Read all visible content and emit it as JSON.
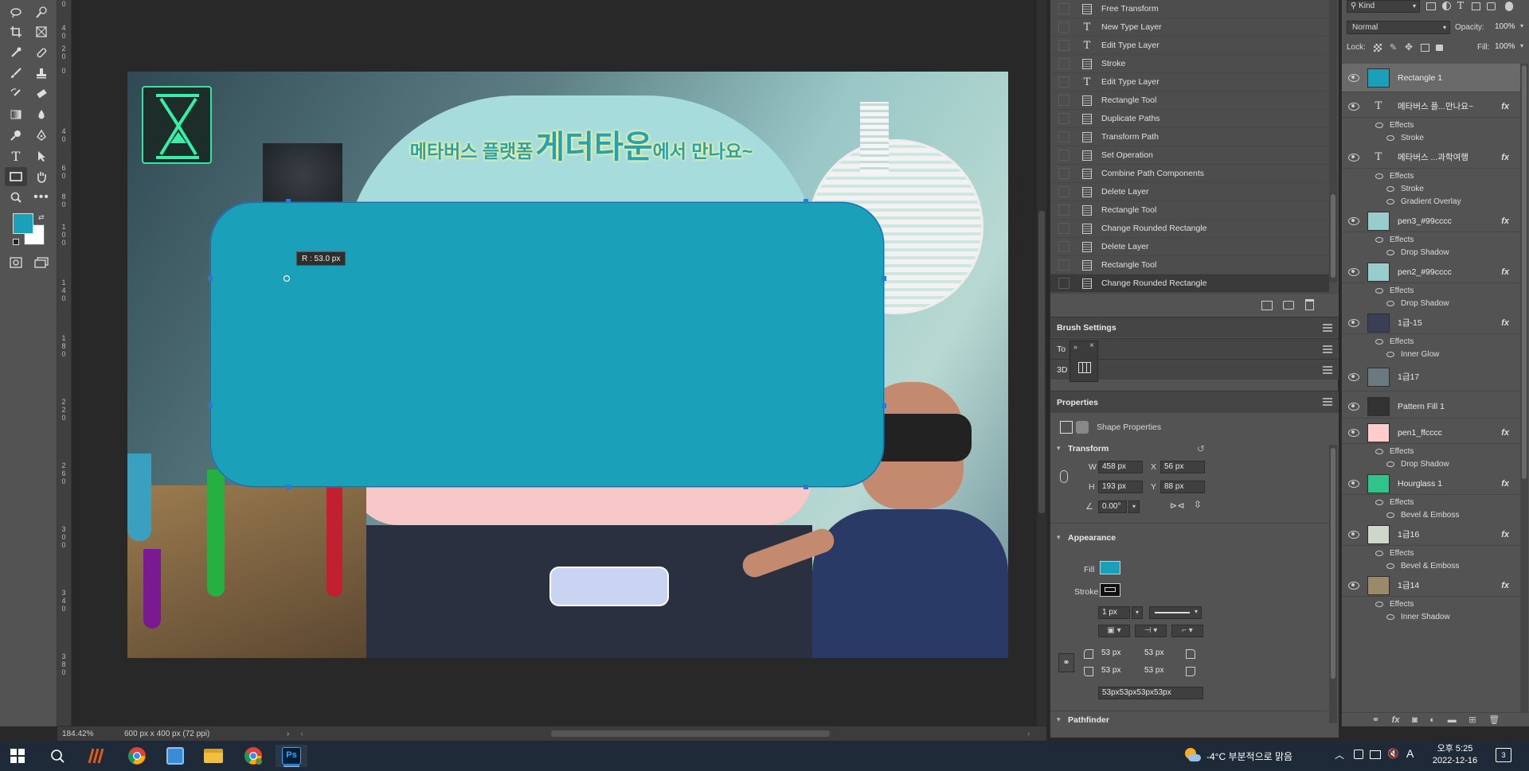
{
  "canvas": {
    "radius_tooltip": "R :  53.0 px",
    "banner_text_small_left": "메타버스 플랫폼",
    "banner_text_large": "게더타운",
    "banner_text_small_right": "에서 만나요~",
    "shape_fill": "#1aa0b8"
  },
  "status": {
    "zoom": "184.42%",
    "doc_info": "600 px x 400 px (72 ppi)"
  },
  "history": {
    "items": [
      {
        "label": "Free Transform",
        "icon": "document-icon"
      },
      {
        "label": "New Type Layer",
        "icon": "type-icon"
      },
      {
        "label": "Edit Type Layer",
        "icon": "type-icon"
      },
      {
        "label": "Stroke",
        "icon": "document-icon"
      },
      {
        "label": "Edit Type Layer",
        "icon": "type-icon"
      },
      {
        "label": "Rectangle Tool",
        "icon": "document-icon"
      },
      {
        "label": "Duplicate Paths",
        "icon": "document-icon"
      },
      {
        "label": "Transform Path",
        "icon": "document-icon"
      },
      {
        "label": "Set Operation",
        "icon": "document-icon"
      },
      {
        "label": "Combine Path Components",
        "icon": "document-icon"
      },
      {
        "label": "Delete Layer",
        "icon": "document-icon"
      },
      {
        "label": "Rectangle Tool",
        "icon": "document-icon"
      },
      {
        "label": "Change Rounded Rectangle",
        "icon": "document-icon"
      },
      {
        "label": "Delete Layer",
        "icon": "document-icon"
      },
      {
        "label": "Rectangle Tool",
        "icon": "document-icon"
      },
      {
        "label": "Change Rounded Rectangle",
        "icon": "document-icon"
      }
    ]
  },
  "panels": {
    "brush_settings": "Brush Settings",
    "tools_tab": "To",
    "tools_tab_end": "s",
    "threed_tab": "3D",
    "properties": "Properties",
    "shape_properties": "Shape Properties"
  },
  "transform": {
    "title": "Transform",
    "w_label": "W",
    "w": "458 px",
    "x_label": "X",
    "x": "56 px",
    "h_label": "H",
    "h": "193 px",
    "y_label": "Y",
    "y": "88 px",
    "angle": "0.00°"
  },
  "appearance": {
    "title": "Appearance",
    "fill_label": "Fill",
    "stroke_label": "Stroke",
    "stroke_width": "1 px",
    "fill_color": "#1aa0b8",
    "corner_tl": "53 px",
    "corner_tr": "53 px",
    "corner_bl": "53 px",
    "corner_br": "53 px",
    "corner_combined": "53px53px53px53px"
  },
  "pathfinder_title": "Pathfinder",
  "layers_panel": {
    "filter_kind": "Kind",
    "blend_mode": "Normal",
    "opacity_label": "Opacity:",
    "opacity": "100%",
    "lock_label": "Lock:",
    "fill_label": "Fill:",
    "fill": "100%",
    "layers": [
      {
        "name": "Rectangle 1",
        "fx": false,
        "effects": [],
        "thumb": "#1aa0b8",
        "selected": true
      },
      {
        "name": "메타버스 플...만나요~",
        "fx": true,
        "type": true,
        "effects": [
          "Effects",
          "Stroke"
        ],
        "thumb": ""
      },
      {
        "name": "메타버스 ...과학여행",
        "fx": true,
        "type": true,
        "effects": [
          "Effects",
          "Stroke",
          "Gradient Overlay"
        ],
        "thumb": ""
      },
      {
        "name": "pen3_#99cccc",
        "fx": true,
        "effects": [
          "Effects",
          "Drop Shadow"
        ],
        "thumb": "#99cccc"
      },
      {
        "name": "pen2_#99cccc",
        "fx": true,
        "effects": [
          "Effects",
          "Drop Shadow"
        ],
        "thumb": "#99cccc"
      },
      {
        "name": "1급-15",
        "fx": true,
        "effects": [
          "Effects",
          "Inner Glow"
        ],
        "thumb": "#3a3f56"
      },
      {
        "name": "1급17",
        "fx": false,
        "effects": [],
        "thumb": "#6a7a80"
      },
      {
        "name": "Pattern Fill 1",
        "fx": false,
        "effects": [],
        "thumb": "#333"
      },
      {
        "name": "pen1_ffcccc",
        "fx": true,
        "effects": [
          "Effects",
          "Drop Shadow"
        ],
        "thumb": "#ffcccc"
      },
      {
        "name": "Hourglass 1",
        "fx": true,
        "effects": [
          "Effects",
          "Bevel & Emboss"
        ],
        "thumb": "#2ec48a"
      },
      {
        "name": "1급16",
        "fx": true,
        "effects": [
          "Effects",
          "Bevel & Emboss"
        ],
        "thumb": "#cfd8c8"
      },
      {
        "name": "1급14",
        "fx": true,
        "effects": [
          "Effects",
          "Inner Shadow"
        ],
        "thumb": "#9a8a6a"
      }
    ]
  },
  "taskbar": {
    "weather": "-4°C  부분적으로 맑음",
    "time": "오후 5:25",
    "date": "2022-12-16",
    "notification_count": "3",
    "apps": [
      "start-icon",
      "search-icon",
      "wacom-icon",
      "chrome-icon",
      "app-icon",
      "file-explorer-icon",
      "chrome-profile-icon",
      "photoshop-icon"
    ],
    "ps_label": "Ps"
  },
  "colors": {
    "foreground": "#1aa0b8",
    "background": "#ffffff"
  }
}
